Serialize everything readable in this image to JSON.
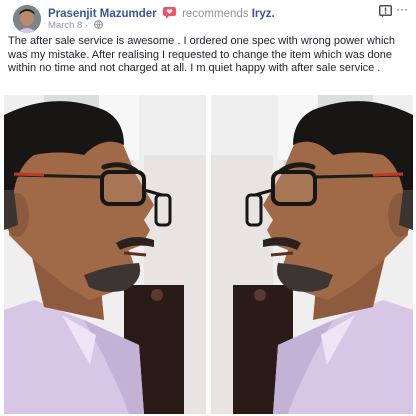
{
  "post": {
    "author_name": "Prasenjit Mazumder",
    "recommends_text": "recommends",
    "page_name": "Iryz.",
    "date": "March 8",
    "date_separator": "·",
    "more_label": "···",
    "body_text": "The after sale service is awesome . I ordered one spec with wrong power which was my mistake. After realising I requested to change the item which was done within no time and not charged at all. I m quiet happy with after sale service ."
  },
  "colors": {
    "link_blue": "#365899",
    "recommend_red": "#f35369",
    "meta_gray": "#90949c",
    "text": "#1d2129"
  }
}
